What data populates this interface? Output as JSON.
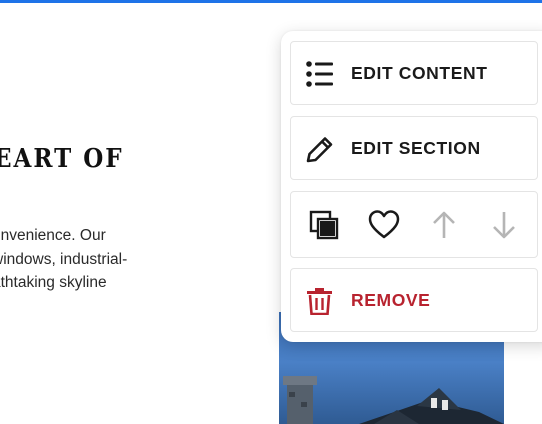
{
  "page": {
    "heading": "EART OF",
    "body_lines": [
      "onvenience. Our",
      "windows, industrial-",
      "athtaking skyline"
    ]
  },
  "menu": {
    "items": [
      {
        "label": "EDIT CONTENT",
        "icon": "list-icon"
      },
      {
        "label": "EDIT SECTION",
        "icon": "pencil-icon"
      },
      {
        "label": "REMOVE",
        "icon": "trash-icon"
      }
    ],
    "actions": [
      {
        "name": "duplicate",
        "icon": "duplicate-icon",
        "enabled": true
      },
      {
        "name": "favorite",
        "icon": "heart-icon",
        "enabled": true
      },
      {
        "name": "move-up",
        "icon": "arrow-up-icon",
        "enabled": false
      },
      {
        "name": "move-down",
        "icon": "arrow-down-icon",
        "enabled": false
      }
    ]
  },
  "colors": {
    "accent_bar": "#1e73e8",
    "remove": "#b8232f",
    "disabled_icon": "#b5b5b5",
    "text": "#1a1a1a"
  }
}
